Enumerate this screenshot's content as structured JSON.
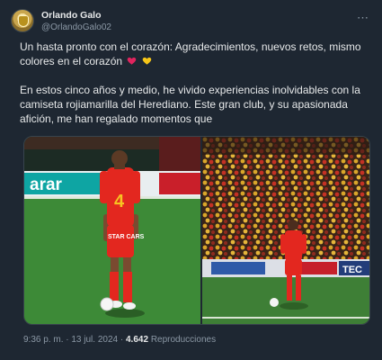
{
  "author": {
    "display_name": "Orlando Galo",
    "handle": "@OrlandoGalo02"
  },
  "menu": {
    "more_icon": "more-horizontal-icon"
  },
  "tweet": {
    "paragraph1": "Un hasta pronto con el corazón: Agradecimientos, nuevos retos, mismo colores en el corazón",
    "paragraph2": "En estos cinco años y medio, he vivido experiencias inolvidables con la camiseta rojiamarilla del Herediano. Este gran club, y su apasionada afición, me han regalado momentos que",
    "emoji": [
      "red-heart-icon",
      "yellow-heart-icon"
    ]
  },
  "media": {
    "left_photo_text": {
      "ad_board": "arar",
      "jersey_number": "4",
      "sponsor": "STAR CARS"
    },
    "right_photo_text": {
      "board": "TEC"
    }
  },
  "meta": {
    "time": "9:36 p. m.",
    "separator": "·",
    "date": "13 jul. 2024",
    "views_count": "4.642",
    "views_label": "Reproducciones"
  },
  "colors": {
    "background": "#1e2732",
    "text": "#e7e9ea",
    "secondary_text": "#8b98a5",
    "heart_red": "#e0245e",
    "heart_yellow": "#f5c518"
  }
}
